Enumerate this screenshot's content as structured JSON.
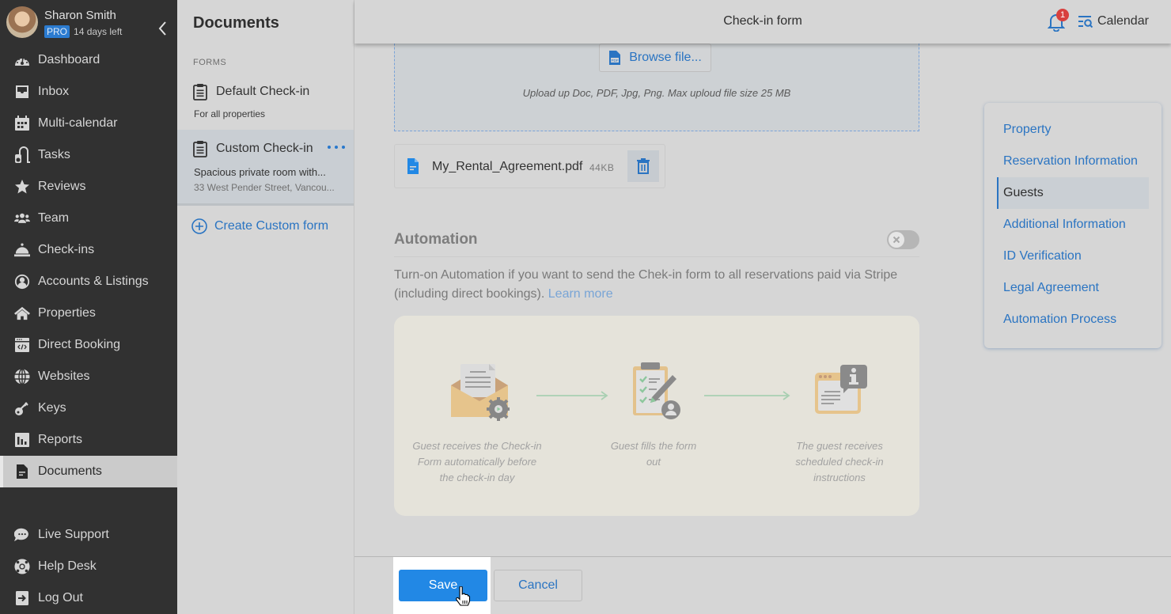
{
  "profile": {
    "name": "Sharon Smith",
    "plan_badge": "PRO",
    "trial_text": "14 days left"
  },
  "sidebar": {
    "items": [
      {
        "label": "Dashboard",
        "icon": "dashboard-gauge-icon"
      },
      {
        "label": "Inbox",
        "icon": "inbox-tray-icon"
      },
      {
        "label": "Multi-calendar",
        "icon": "calendar-icon"
      },
      {
        "label": "Tasks",
        "icon": "vacuum-cleaner-icon"
      },
      {
        "label": "Reviews",
        "icon": "star-icon"
      },
      {
        "label": "Team",
        "icon": "users-icon"
      },
      {
        "label": "Check-ins",
        "icon": "concierge-bell-icon"
      },
      {
        "label": "Accounts & Listings",
        "icon": "user-circle-icon"
      },
      {
        "label": "Properties",
        "icon": "home-icon"
      },
      {
        "label": "Direct Booking",
        "icon": "code-window-icon"
      },
      {
        "label": "Websites",
        "icon": "globe-icon"
      },
      {
        "label": "Keys",
        "icon": "key-icon"
      },
      {
        "label": "Reports",
        "icon": "bar-chart-icon"
      },
      {
        "label": "Documents",
        "icon": "document-icon",
        "active": true
      }
    ],
    "bottom_items": [
      {
        "label": "Live Support",
        "icon": "chat-bubble-icon"
      },
      {
        "label": "Help Desk",
        "icon": "lifebuoy-icon"
      },
      {
        "label": "Log Out",
        "icon": "logout-icon"
      }
    ]
  },
  "documents": {
    "title": "Documents",
    "section_label": "FORMS",
    "forms": [
      {
        "title": "Default Check-in",
        "subtitle": "For all properties"
      },
      {
        "title": "Custom Check-in",
        "subtitle": "Spacious private room with...",
        "address": "33 West Pender Street, Vancou..."
      }
    ],
    "create_label": "Create Custom form"
  },
  "topbar": {
    "title": "Check-in form",
    "notification_count": "1",
    "calendar_label": "Calendar"
  },
  "upload": {
    "browse_label": "Browse file...",
    "hint": "Upload up  Doc, PDF, Jpg, Png. Max uploud file size 25 MB",
    "file": {
      "name": "My_Rental_Agreement.pdf",
      "size": "44KB"
    }
  },
  "automation": {
    "title": "Automation",
    "enabled": false,
    "description": "Turn-on Automation if you want to send the Chek-in form to all reservations paid via Stripe (including direct bookings).",
    "learn_more": "Learn more",
    "steps": [
      {
        "text": "Guest receives the Check-in Form automatically before the check-in day",
        "icon": "envelope-gear-icon"
      },
      {
        "text": "Guest fills the form out",
        "icon": "clipboard-checklist-icon"
      },
      {
        "text": "The guest receives scheduled check-in instructions",
        "icon": "window-info-icon"
      }
    ]
  },
  "section_nav": {
    "items": [
      {
        "label": "Property"
      },
      {
        "label": "Reservation Information"
      },
      {
        "label": "Guests",
        "active": true
      },
      {
        "label": "Additional Information"
      },
      {
        "label": "ID Verification"
      },
      {
        "label": "Legal Agreement"
      },
      {
        "label": "Automation Process"
      }
    ]
  },
  "footer": {
    "save_label": "Save",
    "cancel_label": "Cancel"
  },
  "colors": {
    "accent": "#2288e5",
    "link": "#2a74c2",
    "sidebar_bg": "#313131",
    "badge_red": "#d8403e"
  }
}
